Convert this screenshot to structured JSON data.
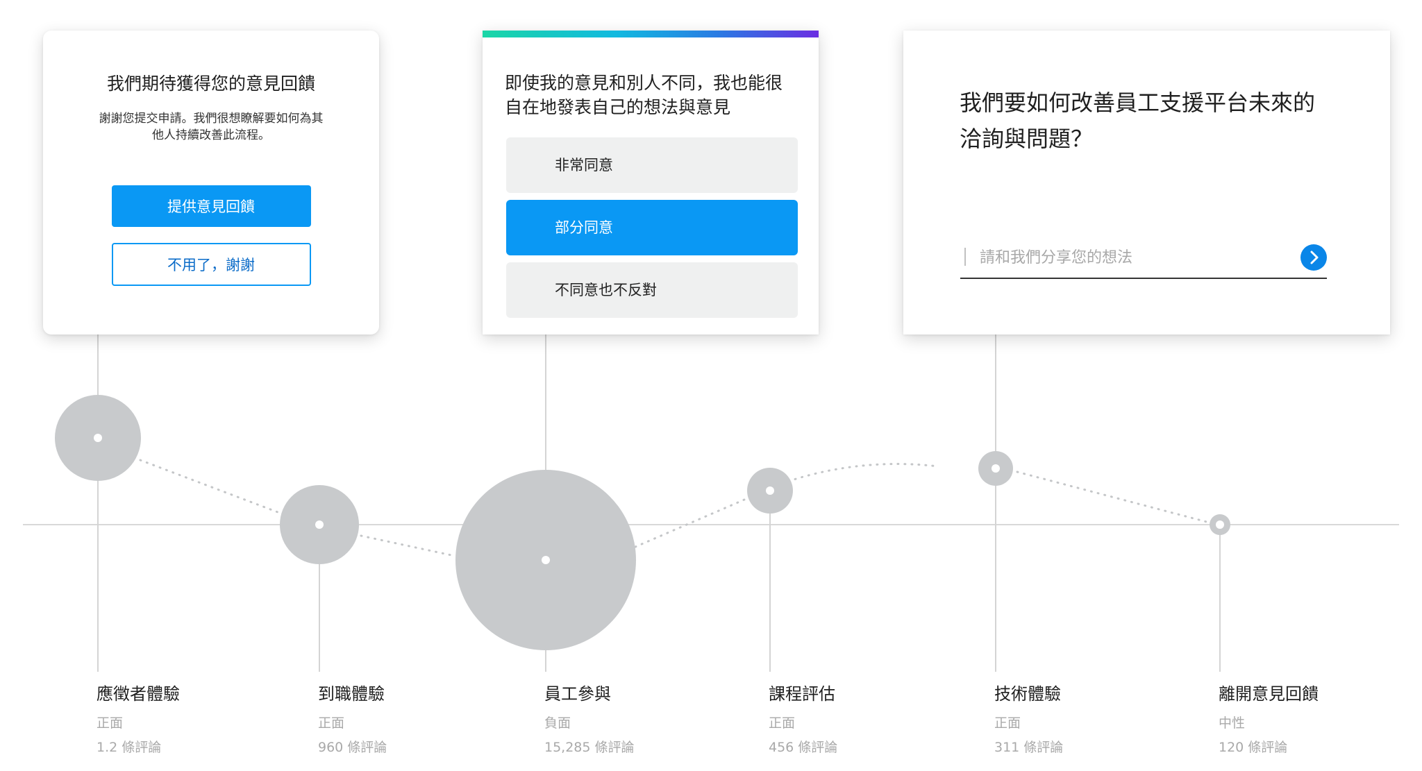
{
  "feedback_card": {
    "title": "我們期待獲得您的意見回饋",
    "description": "謝謝您提交申請。我們很想瞭解要如何為其他人持續改善此流程。",
    "primary_button": "提供意見回饋",
    "secondary_button": "不用了，謝謝"
  },
  "survey_card": {
    "question": "即使我的意見和別人不同，我也能很自在地發表自己的想法與意見",
    "options": [
      "非常同意",
      "部分同意",
      "不同意也不反對"
    ],
    "selected_option": "部分同意"
  },
  "text_card": {
    "question": "我們要如何改善員工支援平台未來的洽詢與問題？",
    "input_placeholder": "請和我們分享您的想法",
    "input_value": "",
    "submit_icon": "chevron-right-icon"
  },
  "timeline": {
    "stages": [
      {
        "name": "應徵者體驗",
        "sentiment": "正面",
        "reviews": "1.2 條評論"
      },
      {
        "name": "到職體驗",
        "sentiment": "正面",
        "reviews": "960 條評論"
      },
      {
        "name": "員工參與",
        "sentiment": "負面",
        "reviews": "15,285 條評論"
      },
      {
        "name": "課程評估",
        "sentiment": "正面",
        "reviews": "456 條評論"
      },
      {
        "name": "技術體驗",
        "sentiment": "正面",
        "reviews": "311 條評論"
      },
      {
        "name": "離開意見回饋",
        "sentiment": "中性",
        "reviews": "120 條評論"
      }
    ]
  },
  "colors": {
    "accent": "#0a98f4",
    "bubble": "#c8cacc",
    "option_bg": "#eff0f0",
    "muted_text": "#a9a9a9"
  }
}
